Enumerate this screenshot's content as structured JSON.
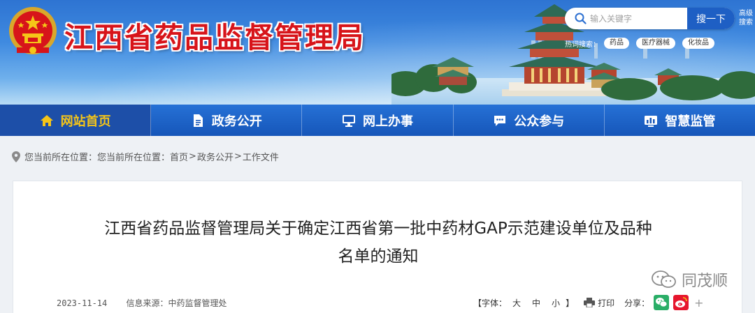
{
  "header": {
    "site_title": "江西省药品监督管理局",
    "search": {
      "placeholder": "输入关键字",
      "button_label": "搜一下",
      "advanced_label": "高级搜索"
    },
    "hot_search": {
      "label": "热词搜索：",
      "tags": [
        "药品",
        "医疗器械",
        "化妆品"
      ]
    }
  },
  "nav": {
    "items": [
      {
        "label": "网站首页",
        "icon": "home-icon",
        "active": true
      },
      {
        "label": "政务公开",
        "icon": "document-icon"
      },
      {
        "label": "网上办事",
        "icon": "monitor-icon"
      },
      {
        "label": "公众参与",
        "icon": "chat-icon"
      },
      {
        "label": "智慧监管",
        "icon": "dashboard-icon"
      }
    ]
  },
  "breadcrumb": {
    "prefix": "您当前所在位置：您当前所在位置：",
    "items": [
      "首页",
      "政务公开",
      "工作文件"
    ],
    "separator": ">"
  },
  "article": {
    "title_line1": "江西省药品监督管理局关于确定江西省第一批中药材GAP示范建设单位及品种",
    "title_line2": "名单的通知",
    "date": "2023-11-14",
    "source": "信息来源：中药监督管理处",
    "font_size_label": "【字体：",
    "font_sizes": [
      "大",
      "中",
      "小"
    ],
    "font_size_close": "】",
    "print_label": "打印",
    "share_label": "分享：",
    "share_plus": "+"
  },
  "watermark": {
    "text": "同茂顺"
  },
  "colors": {
    "brand_red": "#d7141a",
    "nav_blue": "#1656b9",
    "active_gold": "#f5c518",
    "wechat_green": "#2aae67",
    "weibo_red": "#e6162d"
  }
}
